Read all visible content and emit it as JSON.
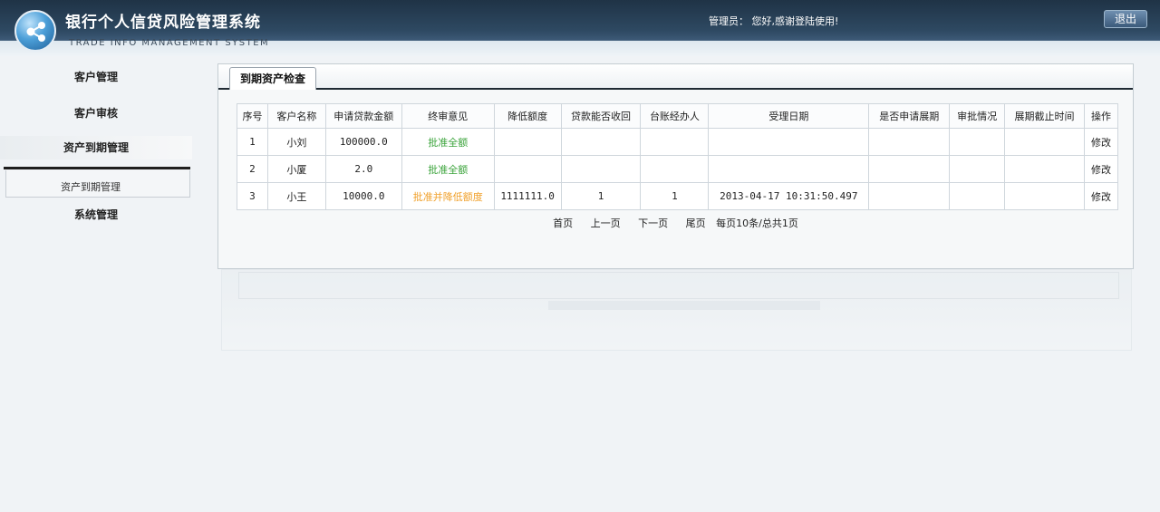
{
  "header": {
    "title": "银行个人信贷风险管理系统",
    "subtitle": "TRADE INFO MANAGEMENT SYSTEM",
    "greeting": "管理员： 您好,感谢登陆使用!",
    "logout_label": "退出"
  },
  "sidebar": {
    "items": [
      {
        "label": "客户管理"
      },
      {
        "label": "客户审核"
      },
      {
        "label": "资产到期管理"
      },
      {
        "label": "系统管理"
      }
    ],
    "submenu": {
      "label": "资产到期管理"
    }
  },
  "main": {
    "tab": "到期资产检查",
    "table": {
      "headers": [
        "序号",
        "客户名称",
        "申请贷款金额",
        "终审意见",
        "降低额度",
        "贷款能否收回",
        "台账经办人",
        "受理日期",
        "是否申请展期",
        "审批情况",
        "展期截止时间",
        "操作"
      ],
      "rows": [
        {
          "no": "1",
          "name": "小刘",
          "amount": "100000.0",
          "opinion": "批准全额",
          "reduce": "",
          "recover": "",
          "handler": "",
          "date": "",
          "extend": "",
          "approval": "",
          "deadline": "",
          "op": "修改"
        },
        {
          "no": "2",
          "name": "小厦",
          "amount": "2.0",
          "opinion": "批准全额",
          "reduce": "",
          "recover": "",
          "handler": "",
          "date": "",
          "extend": "",
          "approval": "",
          "deadline": "",
          "op": "修改"
        },
        {
          "no": "3",
          "name": "小王",
          "amount": "10000.0",
          "opinion": "批准并降低额度",
          "reduce": "1111111.0",
          "recover": "1",
          "handler": "1",
          "date": "2013-04-17 10:31:50.497",
          "extend": "",
          "approval": "",
          "deadline": "",
          "op": "修改"
        }
      ]
    },
    "pager": {
      "first": "首页",
      "prev": "上一页",
      "next": "下一页",
      "last": "尾页",
      "info": "每页10条/总共1页"
    }
  },
  "colors": {
    "header_bg": "#2e4962",
    "approved_full": "#3aa33a",
    "approved_reduced": "#f0a02a"
  }
}
